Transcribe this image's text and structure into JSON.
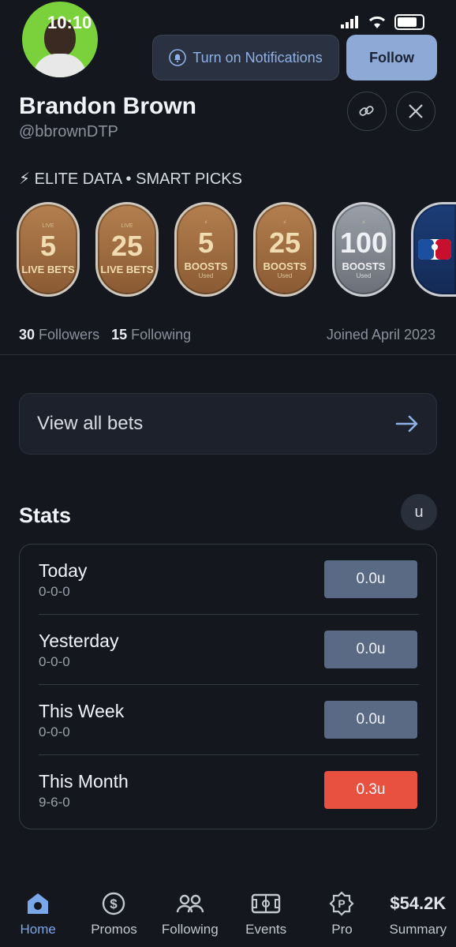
{
  "status": {
    "time": "10:10"
  },
  "header": {
    "notify_label": "Turn on Notifications",
    "follow_label": "Follow"
  },
  "profile": {
    "name": "Brandon Brown",
    "handle": "@bbrownDTP",
    "bio": "⚡ ELITE DATA • SMART PICKS",
    "followers_count": "30",
    "followers_label": "Followers",
    "following_count": "15",
    "following_label": "Following",
    "joined": "Joined April 2023"
  },
  "badges": [
    {
      "value": "5",
      "label": "LIVE BETS",
      "tag": "LIVE",
      "sub": "",
      "kind": "bronze"
    },
    {
      "value": "25",
      "label": "LIVE BETS",
      "tag": "LIVE",
      "sub": "",
      "kind": "bronze"
    },
    {
      "value": "5",
      "label": "BOOSTS",
      "tag": "⚡",
      "sub": "Used",
      "kind": "bronze"
    },
    {
      "value": "25",
      "label": "BOOSTS",
      "tag": "⚡",
      "sub": "Used",
      "kind": "bronze"
    },
    {
      "value": "100",
      "label": "BOOSTS",
      "tag": "⚡",
      "sub": "Used",
      "kind": "silver"
    },
    {
      "value": "",
      "label": "",
      "tag": "",
      "sub": "",
      "kind": "mlb"
    }
  ],
  "view_all": {
    "label": "View all bets"
  },
  "stats": {
    "title": "Stats",
    "unit_toggle": "u",
    "rows": [
      {
        "period": "Today",
        "record": "0-0-0",
        "value": "0.0u"
      },
      {
        "period": "Yesterday",
        "record": "0-0-0",
        "value": "0.0u"
      },
      {
        "period": "This Week",
        "record": "0-0-0",
        "value": "0.0u"
      },
      {
        "period": "This Month",
        "record": "9-6-0",
        "value": "0.3u"
      }
    ]
  },
  "nav": {
    "home": "Home",
    "promos": "Promos",
    "following": "Following",
    "events": "Events",
    "pro": "Pro",
    "summary_value": "$54.2K",
    "summary": "Summary"
  },
  "colors": {
    "background": "#14171e",
    "accent": "#7aa6ea",
    "follow_button": "#8ea9d6",
    "stat_pill": "#5a6a85",
    "stat_pill_highlight": "#e8503f"
  }
}
